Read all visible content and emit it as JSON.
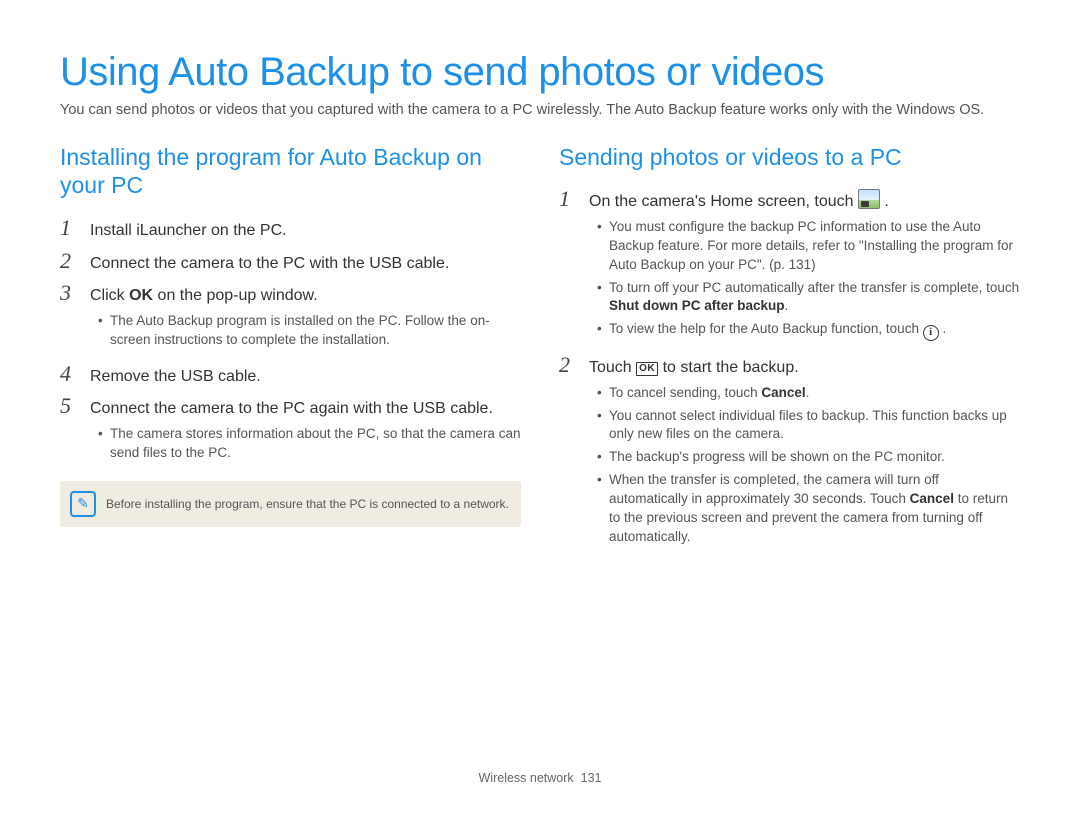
{
  "title": "Using Auto Backup to send photos or videos",
  "intro": "You can send photos or videos that you captured with the camera to a PC wirelessly. The Auto Backup feature works only with the Windows OS.",
  "left": {
    "heading": "Installing the program for Auto Backup on your PC",
    "steps": {
      "s1": "Install iLauncher on the PC.",
      "s2": "Connect the camera to the PC with the USB cable.",
      "s3_a": "Click ",
      "s3_b": "OK",
      "s3_c": " on the pop-up window.",
      "s3_sub1": "The Auto Backup program is installed on the PC. Follow the on-screen instructions to complete the installation.",
      "s4": "Remove the USB cable.",
      "s5": "Connect the camera to the PC again with the USB cable.",
      "s5_sub1": "The camera stores information about the PC, so that the camera can send files to the PC."
    },
    "note": "Before installing the program, ensure that the PC is connected to a network."
  },
  "right": {
    "heading": "Sending photos or videos to a PC",
    "s1_a": "On the camera's Home screen, touch ",
    "s1_sub1": "You must configure the backup PC information to use the Auto Backup feature. For more details, refer to \"Installing the program for Auto Backup on your PC\". (p. 131)",
    "s1_sub2_a": "To turn off your PC automatically after the transfer is complete, touch ",
    "s1_sub2_b": "Shut down PC after backup",
    "s1_sub3_a": "To view the help for the Auto Backup function, touch ",
    "s2_a": "Touch ",
    "s2_b": " to start the backup.",
    "s2_sub1_a": "To cancel sending, touch ",
    "s2_sub1_b": "Cancel",
    "s2_sub2": "You cannot select individual files to backup. This function backs up only new files on the camera.",
    "s2_sub3": "The backup's progress will be shown on the PC monitor.",
    "s2_sub4_a": "When the transfer is completed, the camera will turn off automatically in approximately 30 seconds. Touch ",
    "s2_sub4_b": "Cancel",
    "s2_sub4_c": " to return to the previous screen and prevent the camera from turning off automatically."
  },
  "footer": {
    "section": "Wireless network",
    "page": "131"
  }
}
